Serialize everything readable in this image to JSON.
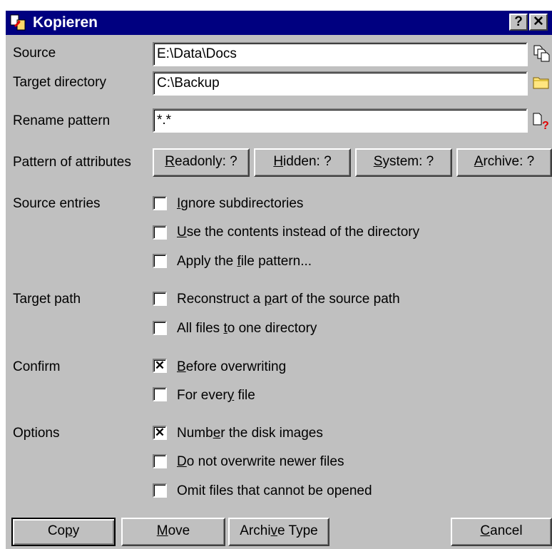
{
  "window": {
    "title": "Kopieren",
    "help_button": "?",
    "close_button": "✕"
  },
  "fields": {
    "source_label": "Source",
    "source_value": "E:\\Data\\Docs",
    "target_label": "Target directory",
    "target_value": "C:\\Backup",
    "rename_label": "Rename pattern",
    "rename_value": "*.*"
  },
  "attributes": {
    "label": "Pattern of attributes",
    "readonly": {
      "pre": "",
      "key": "R",
      "post": "eadonly: ?"
    },
    "hidden": {
      "pre": "",
      "key": "H",
      "post": "idden: ?"
    },
    "system": {
      "pre": "",
      "key": "S",
      "post": "ystem: ?"
    },
    "archive": {
      "pre": "",
      "key": "A",
      "post": "rchive: ?"
    }
  },
  "source_entries": {
    "label": "Source entries",
    "ignore_subdirs": {
      "pre": "",
      "key": "I",
      "post": "gnore subdirectories",
      "checked": false
    },
    "use_contents": {
      "pre": "",
      "key": "U",
      "post": "se the contents instead of the directory",
      "checked": false
    },
    "apply_pattern": {
      "pre": "Apply the ",
      "key": "f",
      "post": "ile pattern...",
      "checked": false
    }
  },
  "target_path": {
    "label": "Target path",
    "reconstruct": {
      "pre": "Reconstruct a ",
      "key": "p",
      "post": "art of the source path",
      "checked": false
    },
    "all_to_one": {
      "pre": "All files ",
      "key": "t",
      "post": "o one directory",
      "checked": false
    }
  },
  "confirm": {
    "label": "Confirm",
    "before_overwriting": {
      "pre": "",
      "key": "B",
      "post": "efore overwriting",
      "checked": true
    },
    "every_file": {
      "pre": "For ever",
      "key": "y",
      "post": " file",
      "checked": false
    }
  },
  "options": {
    "label": "Options",
    "number_images": {
      "pre": "Numb",
      "key": "e",
      "post": "r the disk images",
      "checked": true
    },
    "no_overwrite_newer": {
      "pre": "",
      "key": "D",
      "post": "o not overwrite newer files",
      "checked": false
    },
    "omit_unopenable": {
      "pre": "Omit files that cannot be opened",
      "key": "",
      "post": "",
      "checked": false
    }
  },
  "buttons": {
    "copy": {
      "pre": "Co",
      "key": "p",
      "post": "y"
    },
    "move": {
      "pre": "",
      "key": "M",
      "post": "ove"
    },
    "archive_type": {
      "pre": "Archi",
      "key": "v",
      "post": "e Type"
    },
    "cancel": {
      "pre": "",
      "key": "C",
      "post": "ancel"
    }
  },
  "icons": {
    "title": "copy-files-icon",
    "source_browse": "copy-pages-icon",
    "target_browse": "folder-icon",
    "rename_help": "page-question-icon"
  }
}
